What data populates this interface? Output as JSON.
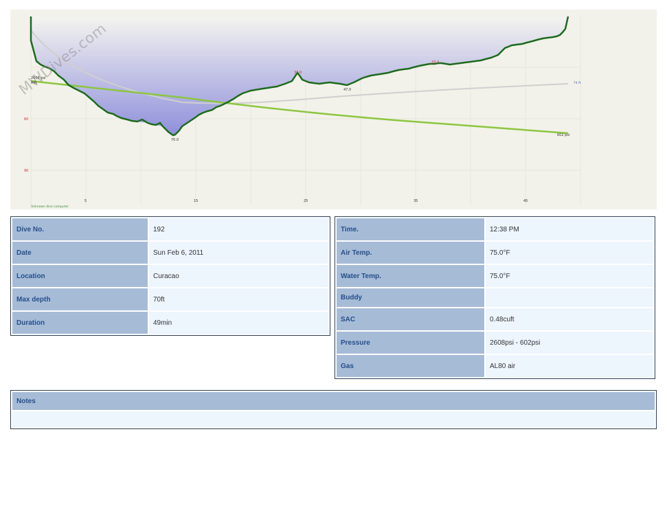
{
  "profile": {
    "watermark": "MWDives.com",
    "start_pressure_label": "2608 psi",
    "start_gas_label": "AIR",
    "end_pressure_label": "602 psi",
    "depth_ticks": [
      "60",
      "90"
    ],
    "time_ticks": [
      "5",
      "15",
      "25",
      "35",
      "45"
    ],
    "max_depth_marker": "70.0",
    "depth_markers": [
      "37.0",
      "47.0",
      "33.0"
    ],
    "temp_end_label": "74 ft",
    "computer_label": "Unknown dive computer"
  },
  "info": {
    "left_rows": [
      {
        "label": "Dive No.",
        "value": "192"
      },
      {
        "label": "Date",
        "value": "Sun Feb 6, 2011"
      },
      {
        "label": "Location",
        "value": "Curacao"
      },
      {
        "label": "Max depth",
        "value": "70ft"
      },
      {
        "label": "Duration",
        "value": "49min"
      }
    ],
    "right_rows": [
      {
        "label": "Time.",
        "value": "12:38 PM"
      },
      {
        "label": "Air Temp.",
        "value": "75.0°F"
      },
      {
        "label": "Water Temp.",
        "value": "75.0°F"
      },
      {
        "label": "Buddy",
        "value": ""
      },
      {
        "label": "SAC",
        "value": "0.48cuft"
      },
      {
        "label": "Pressure",
        "value": "2608psi - 602psi"
      },
      {
        "label": "Gas",
        "value": "AL80 air"
      }
    ]
  },
  "notes": {
    "label": "Notes",
    "value": ""
  },
  "colors": {
    "label_bg": "#a6bbd6",
    "label_text": "#254f8a",
    "value_bg": "#edf5fd",
    "profile_bg": "#f2f2ea",
    "depth_fill": "#a6a6e0",
    "depth_line": "#1d6b1d",
    "pressure_line": "#8cc63f"
  }
}
